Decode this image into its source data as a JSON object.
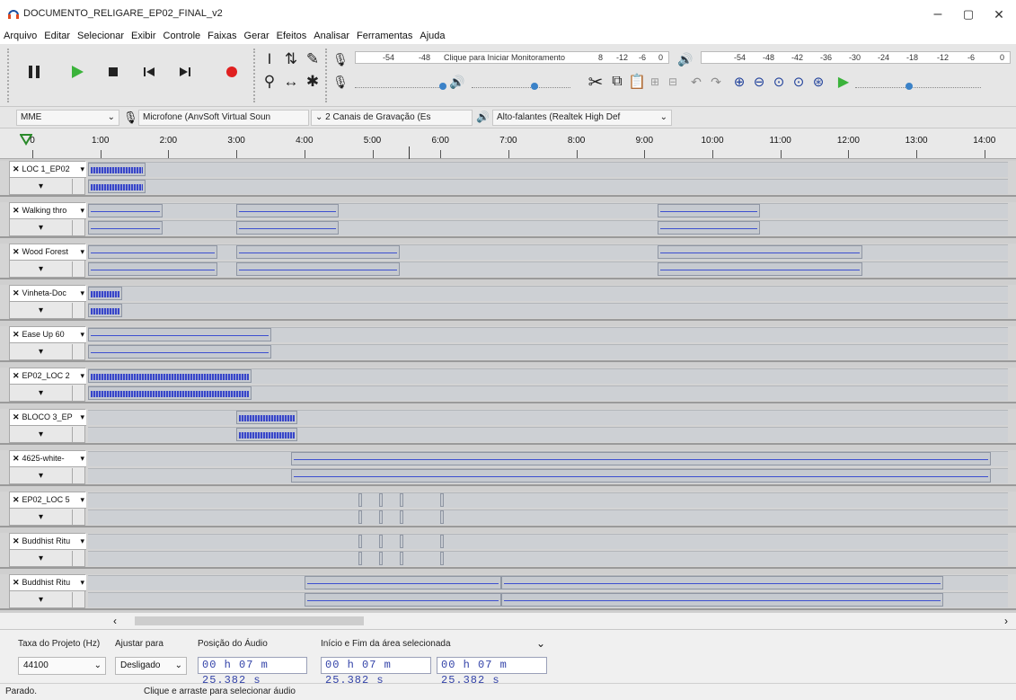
{
  "window": {
    "title": "DOCUMENTO_RELIGARE_EP02_FINAL_v2",
    "minimize": "–",
    "maximize": "▢",
    "close": "✕"
  },
  "menu": [
    "Arquivo",
    "Editar",
    "Selecionar",
    "Exibir",
    "Controle",
    "Faixas",
    "Gerar",
    "Efeitos",
    "Analisar",
    "Ferramentas",
    "Ajuda"
  ],
  "meters": {
    "record_ticks": [
      "-54",
      "-48"
    ],
    "record_hint": "Clique para Iniciar Monitoramento",
    "record_ticks2": [
      "8",
      "-12",
      "-6",
      "0"
    ],
    "play_ticks": [
      "-54",
      "-48",
      "-42",
      "-36",
      "-30",
      "-24",
      "-18",
      "-12",
      "-6",
      "0"
    ]
  },
  "devices": {
    "host": "MME",
    "mic": "Microfone (AnvSoft Virtual Soun",
    "channels": "2 Canais de Gravação (Es",
    "speaker": "Alto-falantes (Realtek High Def"
  },
  "ruler": [
    "0",
    "1:00",
    "2:00",
    "3:00",
    "4:00",
    "5:00",
    "6:00",
    "7:00",
    "8:00",
    "9:00",
    "10:00",
    "11:00",
    "12:00",
    "13:00",
    "14:00"
  ],
  "tracks": [
    {
      "name": "LOC 1_EP02"
    },
    {
      "name": "Walking thro"
    },
    {
      "name": "Wood Forest"
    },
    {
      "name": "Vinheta-Doc"
    },
    {
      "name": "Ease Up 60"
    },
    {
      "name": "EP02_LOC 2"
    },
    {
      "name": "BLOCO 3_EP"
    },
    {
      "name": "4625-white-"
    },
    {
      "name": "EP02_LOC 5"
    },
    {
      "name": "Buddhist Ritu"
    },
    {
      "name": "Buddhist Ritu"
    }
  ],
  "bottom": {
    "rate_label": "Taxa do Projeto (Hz)",
    "rate_value": "44100",
    "snap_label": "Ajustar para",
    "snap_value": "Desligado",
    "pos_label": "Posição do Áudio",
    "pos_value": "00 h 07 m 25.382 s",
    "sel_label": "Início e Fim da área selecionada",
    "sel_start": "00 h 07 m 25.382 s",
    "sel_end": "00 h 07 m 25.382 s"
  },
  "status": {
    "left": "Parado.",
    "hint": "Clique e arraste para selecionar áudio"
  },
  "colors": {
    "wave": "#3c4fd0",
    "clip": "#c6cad0",
    "record": "#e02020",
    "play": "#3bb33b",
    "time_text": "#3242a8"
  }
}
